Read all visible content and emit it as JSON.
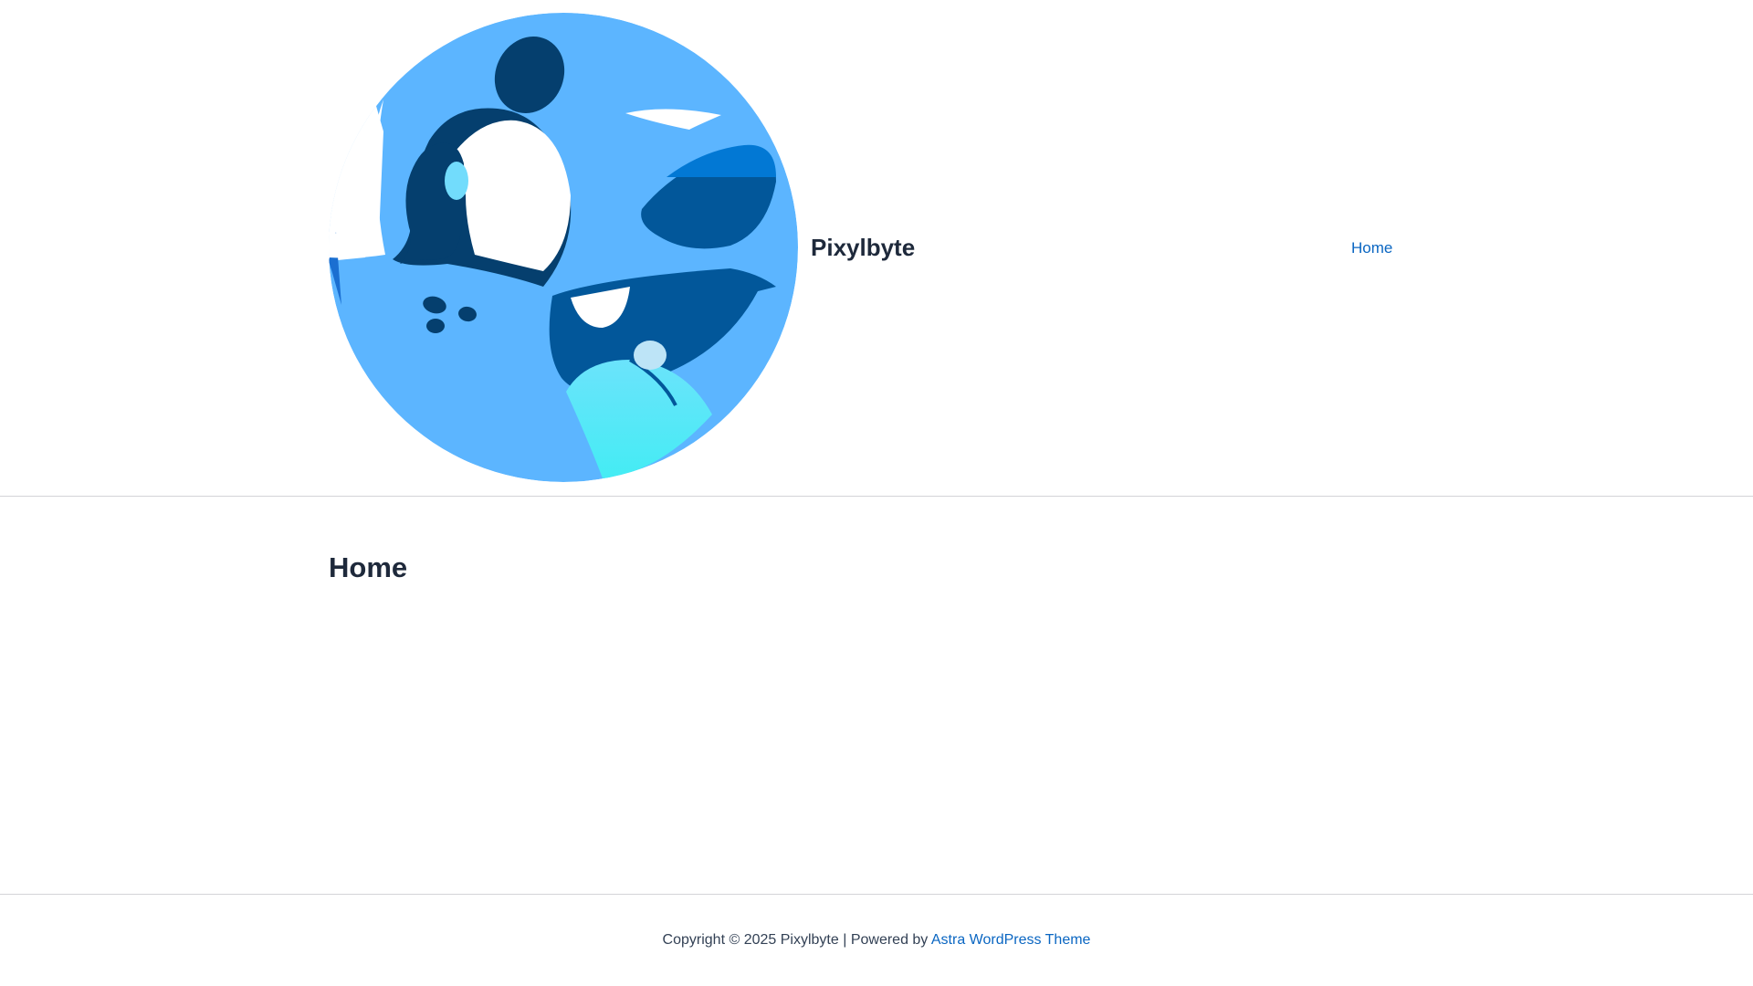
{
  "header": {
    "site_title": "Pixylbyte",
    "logo_icon": "blue-monster-mascot-logo",
    "nav": [
      {
        "label": "Home"
      }
    ]
  },
  "main": {
    "page_title": "Home"
  },
  "footer": {
    "copyright_text": "Copyright © 2025 Pixylbyte | Powered by",
    "theme_link_label": "Astra WordPress Theme"
  },
  "colors": {
    "link": "#0a66c2",
    "heading": "#1e293b",
    "logo_light_blue": "#5cb5ff",
    "logo_dark_blue": "#053f6e",
    "logo_mid_blue": "#02579a",
    "logo_cyan": "#5de8f7"
  }
}
